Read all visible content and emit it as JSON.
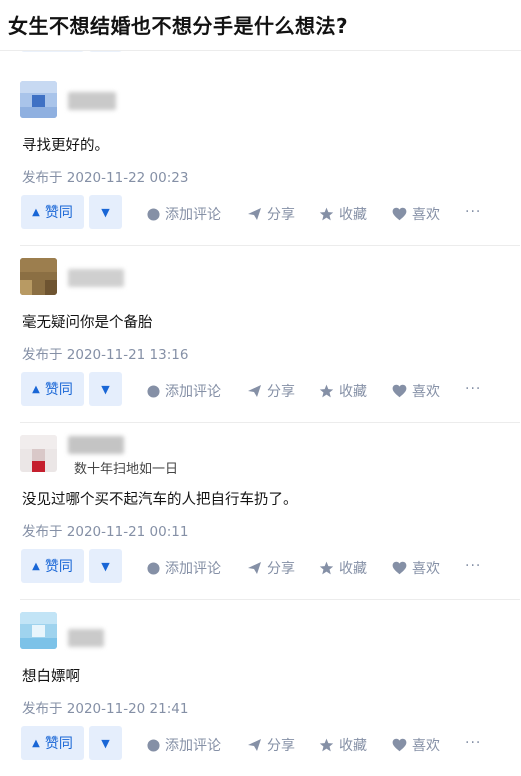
{
  "question": {
    "title": "女生不想结婚也不想分手是什么想法?"
  },
  "actions": {
    "upvote_label": "赞同",
    "comment_label": "添加评论",
    "share_label": "分享",
    "collect_label": "收藏",
    "like_label": "喜欢",
    "more_label": "···"
  },
  "answers": [
    {
      "author_bio": "",
      "content": "寻找更好的。",
      "published": "发布于 2020-11-22 00:23"
    },
    {
      "author_bio": "",
      "content": "毫无疑问你是个备胎",
      "published": "发布于 2020-11-21 13:16"
    },
    {
      "author_bio": "数十年扫地如一日",
      "content": "没见过哪个买不起汽车的人把自行车扔了。",
      "published": "发布于 2020-11-21 00:11"
    },
    {
      "author_bio": "",
      "content": "想白嫖啊",
      "published": "发布于 2020-11-20 21:41"
    }
  ],
  "colors": {
    "accent": "#1966d6",
    "accent_bg": "#e5eefc",
    "meta": "#8590a6",
    "text": "#121212"
  }
}
